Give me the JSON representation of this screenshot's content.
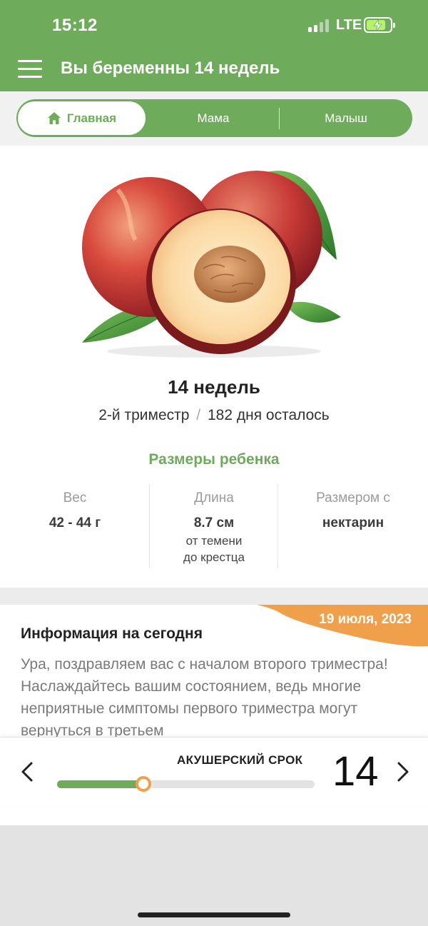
{
  "status_bar": {
    "time": "15:12",
    "network": "LTE"
  },
  "header": {
    "title": "Вы беременны 14 недель"
  },
  "tabs": [
    {
      "label": "Главная",
      "active": true
    },
    {
      "label": "Мама",
      "active": false
    },
    {
      "label": "Малыш",
      "active": false
    }
  ],
  "week": {
    "title": "14 недель",
    "trimester": "2-й триместр",
    "separator": "/",
    "days_left": "182 дня осталось"
  },
  "sizes": {
    "title": "Размеры ребенка",
    "weight": {
      "label": "Вес",
      "value": "42 - 44 г"
    },
    "length": {
      "label": "Длина",
      "value": "8.7 см",
      "note_line1": "от темени",
      "note_line2": "до крестца"
    },
    "compare": {
      "label": "Размером с",
      "value": "нектарин"
    }
  },
  "info": {
    "date": "19 июля, 2023",
    "title": "Информация на сегодня",
    "text": "Ура, поздравляем вас с началом второго триместра! Наслаждайтесь вашим состоянием, ведь многие неприятные симптомы первого триместра могут вернуться в третьем"
  },
  "term": {
    "label": "АКУШЕРСКИЙ СРОК",
    "week_number": "14",
    "progress_fraction": 0.335
  },
  "colors": {
    "brand_green": "#6eab5b",
    "accent_orange": "#f0a04b"
  }
}
